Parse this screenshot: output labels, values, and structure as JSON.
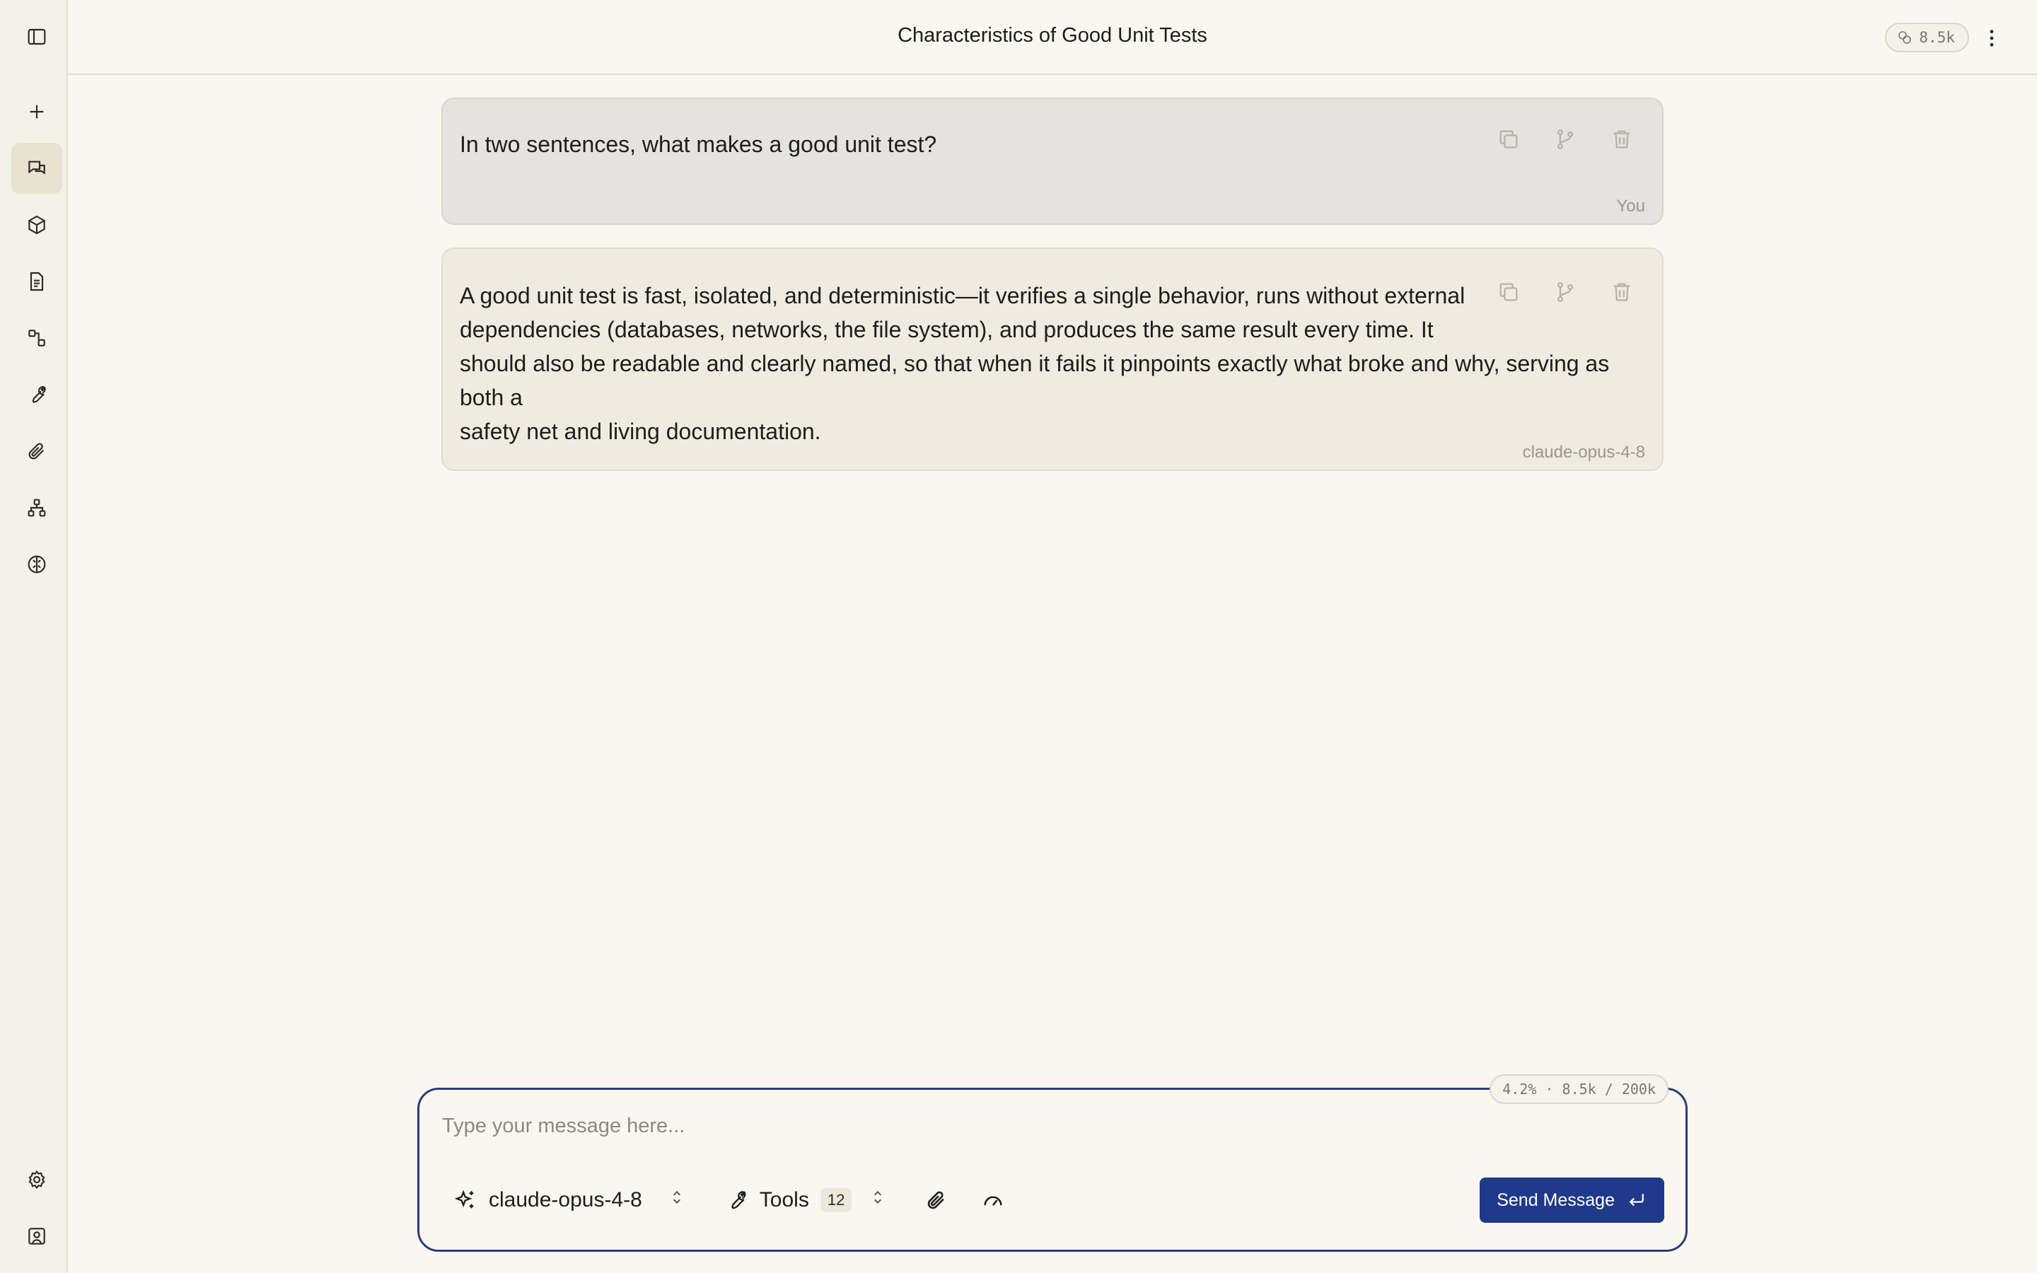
{
  "header": {
    "title": "Characteristics of Good Unit Tests",
    "token_count": "8.5k"
  },
  "sidebar": {
    "items": [
      {
        "name": "new-chat",
        "icon": "plus-icon"
      },
      {
        "name": "chats",
        "icon": "chat-bubbles-icon",
        "active": true
      },
      {
        "name": "models",
        "icon": "cube-icon"
      },
      {
        "name": "documents",
        "icon": "document-icon"
      },
      {
        "name": "workflows",
        "icon": "flow-icon"
      },
      {
        "name": "tools",
        "icon": "wrench-icon"
      },
      {
        "name": "attachments",
        "icon": "paperclip-icon"
      },
      {
        "name": "hierarchy",
        "icon": "hierarchy-icon"
      },
      {
        "name": "brain",
        "icon": "brain-icon"
      }
    ],
    "bottom": [
      {
        "name": "settings",
        "icon": "gear-icon"
      },
      {
        "name": "profile",
        "icon": "user-card-icon"
      }
    ]
  },
  "messages": [
    {
      "role": "user",
      "text": "In two sentences, what makes a good unit test?",
      "author": "You"
    },
    {
      "role": "assistant",
      "lines": [
        "A good unit test is fast, isolated, and deterministic—it verifies a single behavior, runs without external",
        "dependencies (databases, networks, the file system), and produces the same result every time. It",
        "should also be readable and clearly named, so that when it fails it pinpoints exactly what broke and why, serving as both a",
        "safety net and living documentation."
      ],
      "author": "claude-opus-4-8"
    }
  ],
  "composer": {
    "placeholder": "Type your message here...",
    "value": "",
    "usage": "4.2% · 8.5k / 200k",
    "model": "claude-opus-4-8",
    "tools_label": "Tools",
    "tools_count": "12",
    "send_label": "Send Message"
  },
  "colors": {
    "accent": "#1f3a8a",
    "composer_border": "#2c3b7a",
    "background": "#f9f7f0"
  }
}
